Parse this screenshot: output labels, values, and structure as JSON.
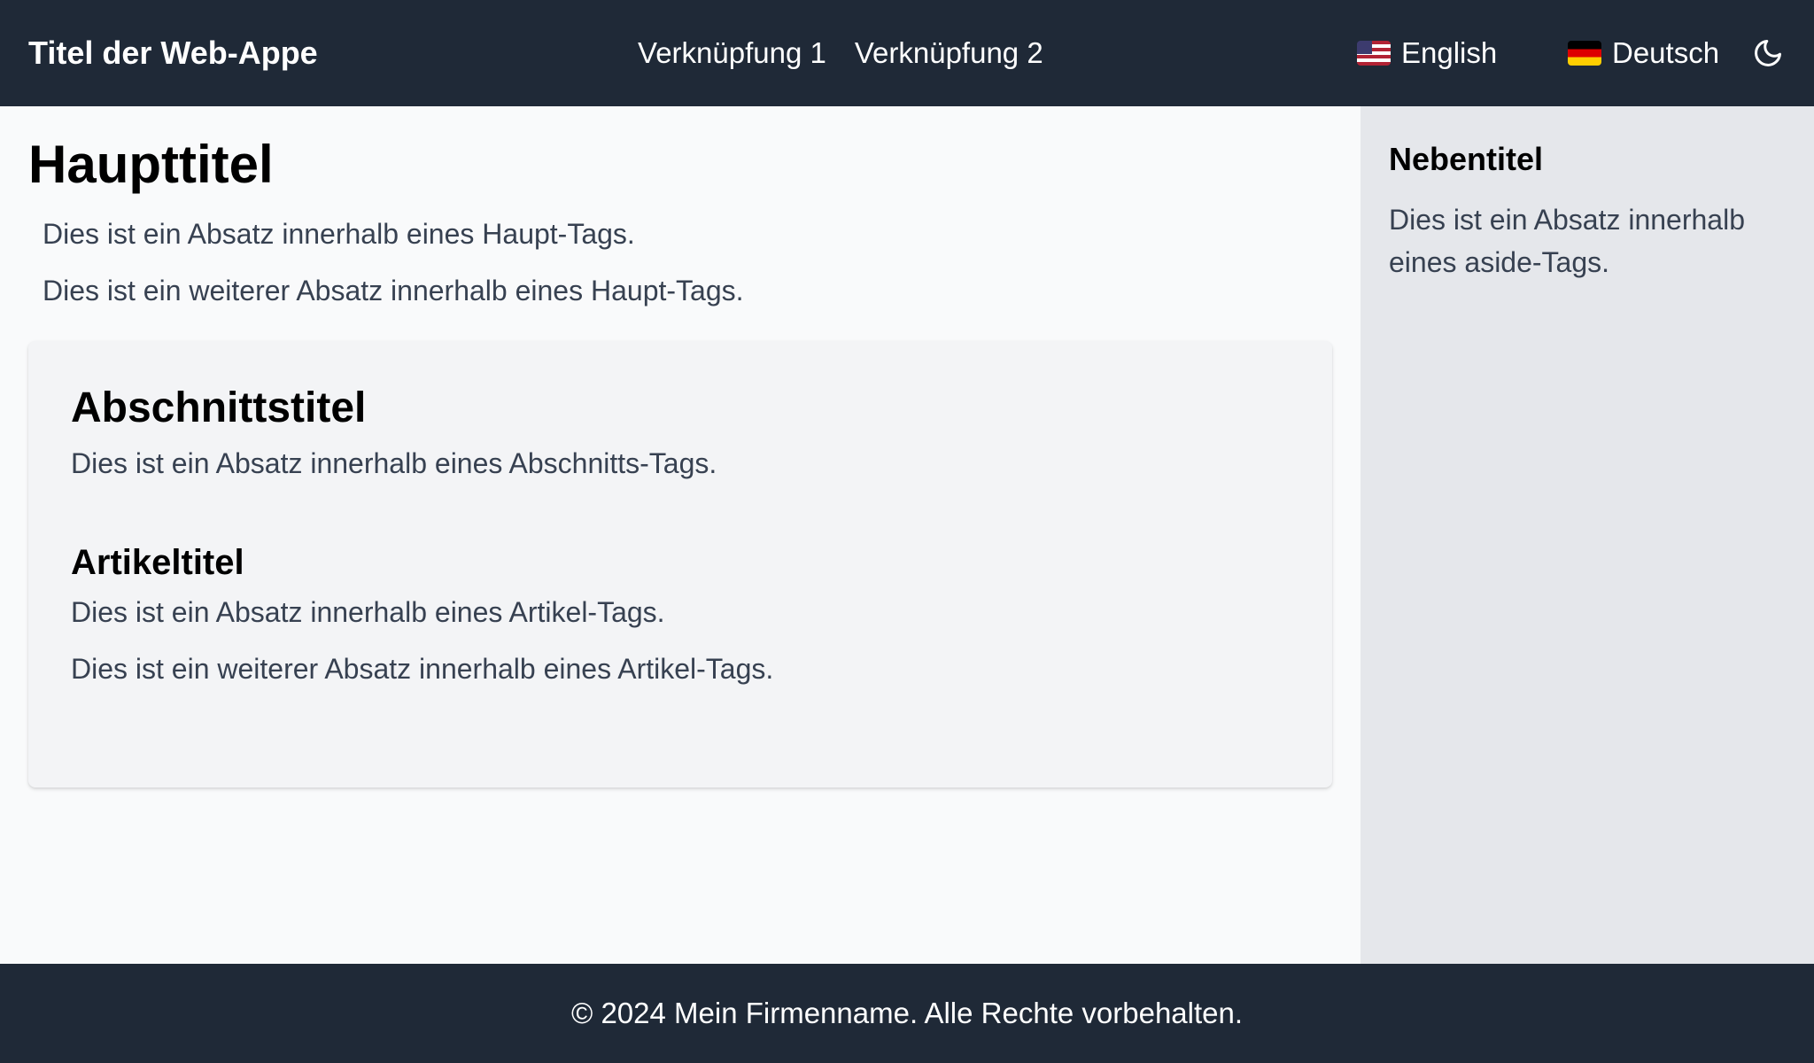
{
  "header": {
    "title": "Titel der Web-Appe",
    "nav": [
      {
        "label": "Verknüpfung 1"
      },
      {
        "label": "Verknüpfung 2"
      }
    ],
    "languages": [
      {
        "label": "English",
        "flag": "us-flag-icon"
      },
      {
        "label": "Deutsch",
        "flag": "de-flag-icon"
      }
    ],
    "theme_toggle_icon": "moon-icon"
  },
  "main": {
    "title": "Haupttitel",
    "paragraphs": [
      "Dies ist ein Absatz innerhalb eines Haupt-Tags.",
      "Dies ist ein weiterer Absatz innerhalb eines Haupt-Tags."
    ],
    "section": {
      "title": "Abschnittstitel",
      "paragraph": "Dies ist ein Absatz innerhalb eines Abschnitts-Tags.",
      "article": {
        "title": "Artikeltitel",
        "paragraphs": [
          "Dies ist ein Absatz innerhalb eines Artikel-Tags.",
          "Dies ist ein weiterer Absatz innerhalb eines Artikel-Tags."
        ]
      }
    }
  },
  "aside": {
    "title": "Nebentitel",
    "paragraph": "Dies ist ein Absatz innerhalb eines aside-Tags."
  },
  "footer": {
    "text": "© 2024 Mein Firmenname. Alle Rechte vorbehalten."
  },
  "colors": {
    "header_bg": "#1f2937",
    "main_bg": "#f9fafb",
    "section_bg": "#f3f4f6",
    "aside_bg": "#e5e7eb",
    "body_text": "#374151"
  }
}
